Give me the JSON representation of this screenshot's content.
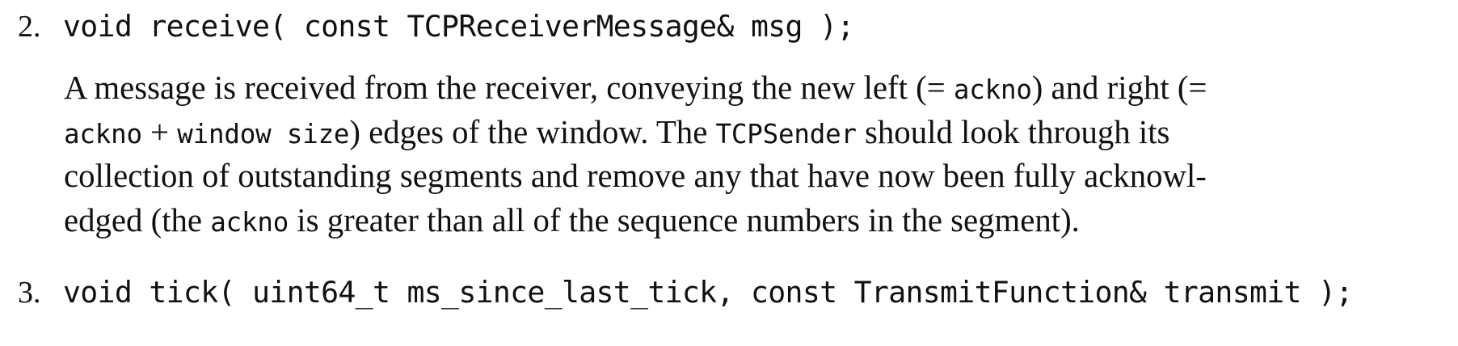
{
  "items": [
    {
      "number": "2.",
      "signature": "void receive( const TCPReceiverMessage& msg );",
      "description": [
        [
          {
            "t": "A message is received from the receiver, conveying the new left (= ",
            "code": false
          },
          {
            "t": "ackno",
            "code": true
          },
          {
            "t": ") and right (=",
            "code": false
          }
        ],
        [
          {
            "t": "ackno",
            "code": true
          },
          {
            "t": " + ",
            "code": false
          },
          {
            "t": "window size",
            "code": true
          },
          {
            "t": ") edges of the window. The ",
            "code": false
          },
          {
            "t": "TCPSender",
            "code": true
          },
          {
            "t": " should look through its",
            "code": false
          }
        ],
        [
          {
            "t": "collection of outstanding segments and remove any that have now been fully acknowl-",
            "code": false
          }
        ],
        [
          {
            "t": "edged (the ",
            "code": false
          },
          {
            "t": "ackno",
            "code": true
          },
          {
            "t": " is greater than all of the sequence numbers in the segment).",
            "code": false
          }
        ]
      ]
    },
    {
      "number": "3.",
      "signature": "void tick( uint64_t ms_since_last_tick, const TransmitFunction& transmit );"
    }
  ]
}
